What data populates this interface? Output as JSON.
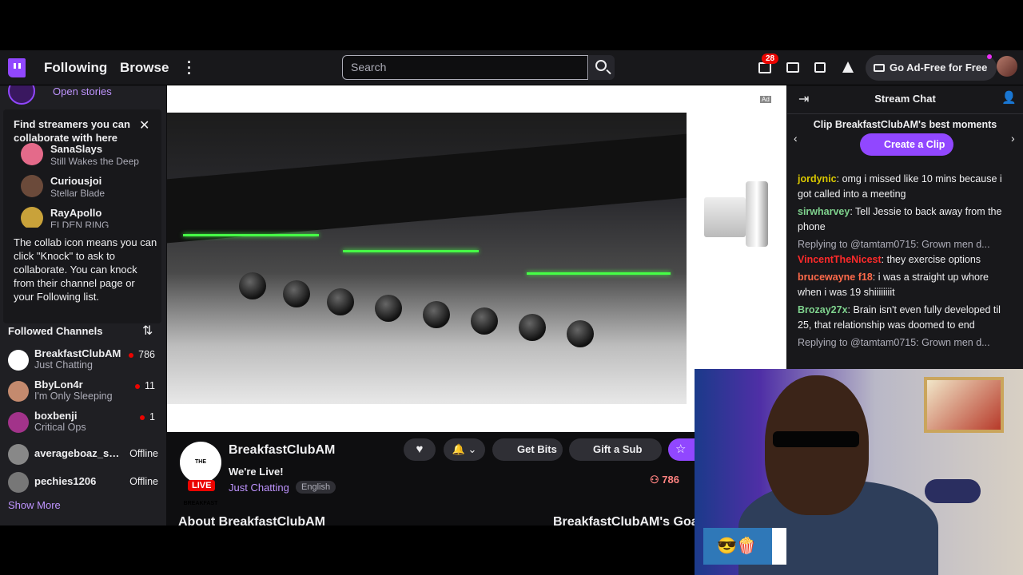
{
  "nav": {
    "following": "Following",
    "browse": "Browse",
    "search_placeholder": "Search",
    "notification_count": "28",
    "ad_free": "Go Ad-Free for Free"
  },
  "sidebar": {
    "open_stories": "Open stories",
    "collab_title": "Find streamers you can collaborate with here",
    "collab_channels": [
      {
        "name": "SanaSlays",
        "game": "Still Wakes the Deep"
      },
      {
        "name": "Curiousjoi",
        "game": "Stellar Blade"
      },
      {
        "name": "RayApollo",
        "game": "ELDEN RING"
      }
    ],
    "collab_text": "The collab icon means you can click \"Knock\" to ask to collaborate. You can knock from their channel page or your Following list.",
    "followed_title": "Followed Channels",
    "channels": [
      {
        "name": "BreakfastClubAM",
        "game": "Just Chatting",
        "viewers": "786"
      },
      {
        "name": "BbyLon4r",
        "game": "I'm Only Sleeping",
        "viewers": "11"
      },
      {
        "name": "boxbenji",
        "game": "Critical Ops",
        "viewers": "1"
      },
      {
        "name": "averageboaz_sp...",
        "status": "Offline"
      },
      {
        "name": "pechies1206",
        "status": "Offline"
      }
    ],
    "show_more": "Show More"
  },
  "stream": {
    "channel": "BreakfastClubAM",
    "logo_text": "THE BREAKFAST CLUB",
    "title": "We're Live!",
    "category": "Just Chatting",
    "language": "English",
    "live": "LIVE",
    "viewers": "786",
    "get_bits": "Get Bits",
    "gift_sub": "Gift a Sub",
    "about": "About BreakfastClubAM",
    "goals": "BreakfastClubAM's Goals",
    "ad_badge": "Ad"
  },
  "chat": {
    "title": "Stream Chat",
    "clip_prompt": "Clip BreakfastClubAM's best moments",
    "clip_button": "Create a Clip",
    "messages": [
      {
        "user": "jordynic",
        "color": "#d9c700",
        "text": ": omg i missed like 10 mins because i got called into a meeting"
      },
      {
        "user": "sirwharvey",
        "color": "#7fd38e",
        "text": ": Tell Jessie to back away from the phone"
      },
      {
        "reply": "Replying to @tamtam0715: Grown men d...",
        "user": "VincentTheNicest",
        "color": "#ff2a2a",
        "text": ": they exercise options"
      },
      {
        "user": "brucewayne f18",
        "color": "#ff6a4a",
        "text": ": i was a straight up whore when i was 19 shiiiiiiiit"
      },
      {
        "user": "Brozay27x",
        "color": "#7fd38e",
        "text": ": Brain isn't even fully developed til 25, that relationship was doomed to end"
      },
      {
        "reply": "Replying to @tamtam0715: Grown men d..."
      }
    ]
  },
  "colors": {
    "accent": "#9147ff",
    "live": "#eb0400"
  }
}
